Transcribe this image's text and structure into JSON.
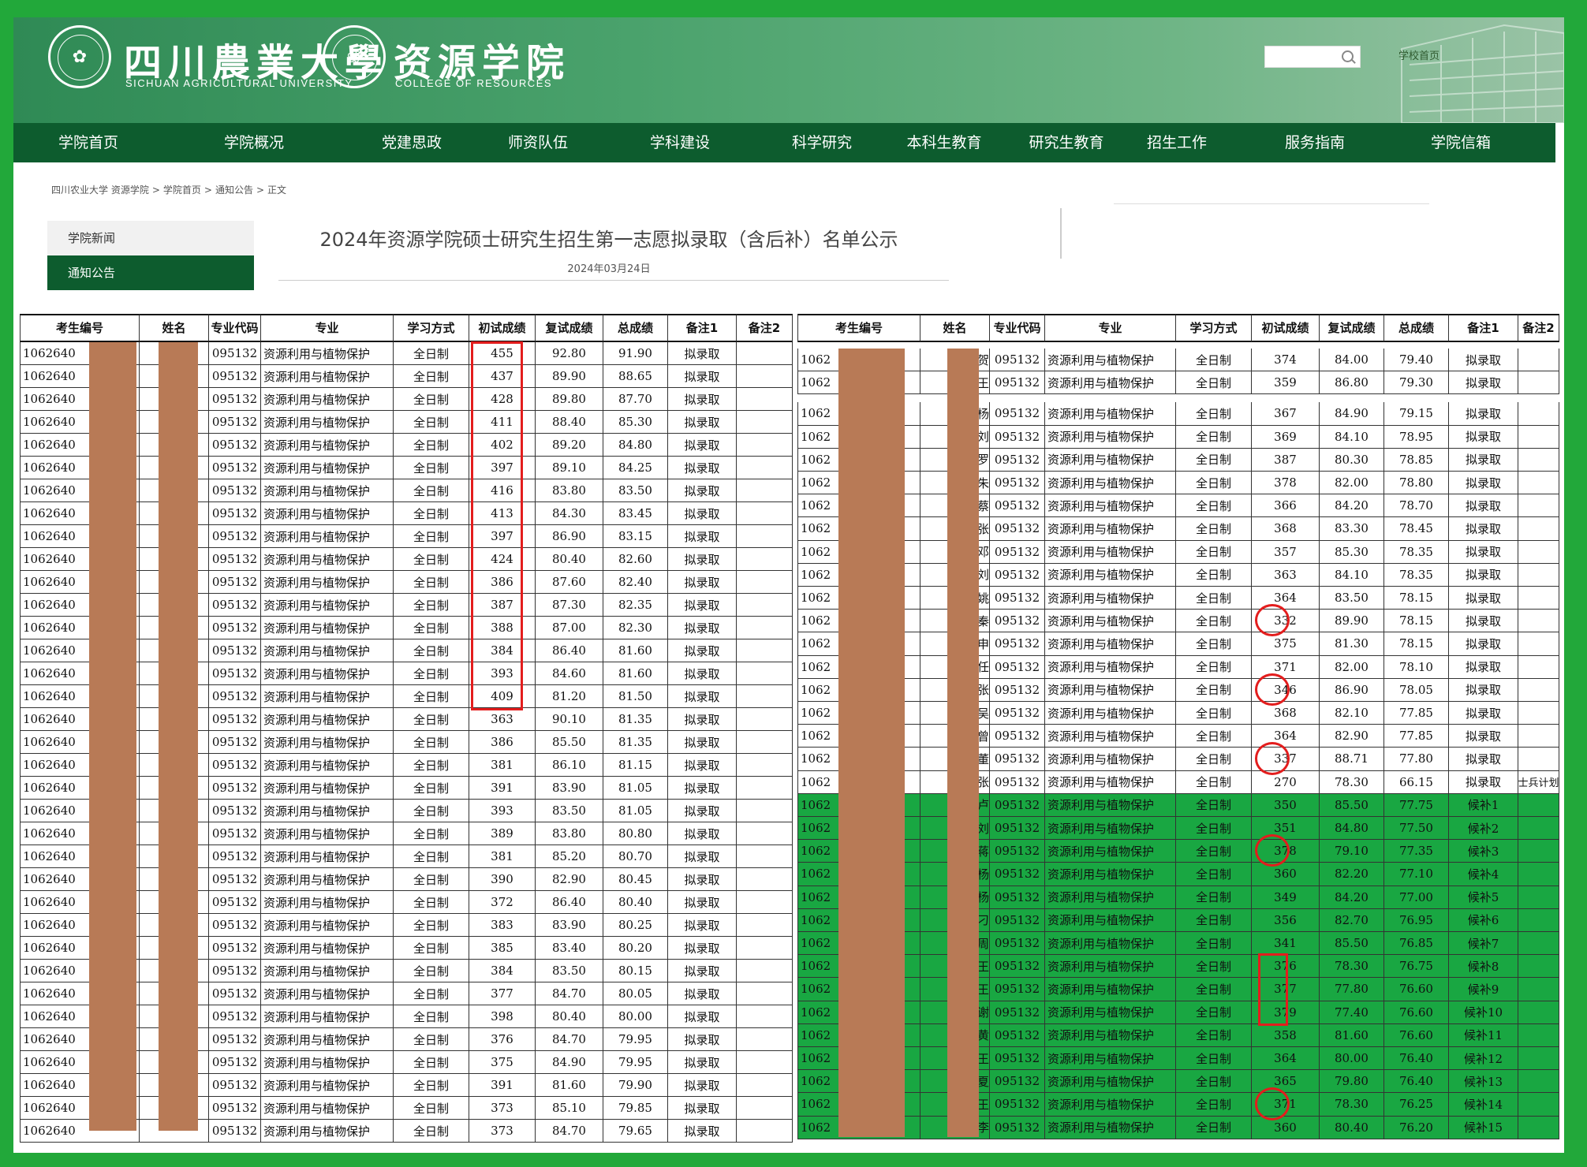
{
  "header": {
    "univ_cn": "四川農業大學",
    "univ_en": "SICHUAN AGRICULTURAL UNIVERSITY",
    "college_cn": "资源学院",
    "college_en": "COLLEGE OF RESOURCES",
    "home_link": "学校首页",
    "univ_seal_icon": "university-seal-icon",
    "college_seal_icon": "college-seal-icon",
    "search_icon": "search-icon"
  },
  "nav": [
    "学院首页",
    "学院概况",
    "党建思政",
    "师资队伍",
    "学科建设",
    "科学研究",
    "本科生教育",
    "研究生教育",
    "招生工作",
    "服务指南",
    "学院信箱"
  ],
  "breadcrumb": [
    "四川农业大学 资源学院",
    ">",
    "学院首页",
    ">",
    "通知公告",
    ">",
    "正文"
  ],
  "sidebar": [
    "学院新闻",
    "通知公告"
  ],
  "article": {
    "title": "2024年资源学院硕士研究生招生第一志愿拟录取（含后补）名单公示",
    "date": "2024年03月24日"
  },
  "table_headers": [
    "考生编号",
    "姓名",
    "专业代码",
    "专业",
    "学习方式",
    "初试成绩",
    "复试成绩",
    "总成绩",
    "备注1",
    "备注2"
  ],
  "common": {
    "id_prefix_left": "1062640",
    "id_prefix_right": "1062",
    "major_code": "095132",
    "major": "资源利用与植物保护",
    "study_mode": "全日制"
  },
  "left_rows": [
    [
      "455",
      "92.80",
      "91.90",
      "拟录取"
    ],
    [
      "437",
      "89.90",
      "88.65",
      "拟录取"
    ],
    [
      "428",
      "89.80",
      "87.70",
      "拟录取"
    ],
    [
      "411",
      "88.40",
      "85.30",
      "拟录取"
    ],
    [
      "402",
      "89.20",
      "84.80",
      "拟录取"
    ],
    [
      "397",
      "89.10",
      "84.25",
      "拟录取"
    ],
    [
      "416",
      "83.80",
      "83.50",
      "拟录取"
    ],
    [
      "413",
      "84.30",
      "83.45",
      "拟录取"
    ],
    [
      "397",
      "86.90",
      "83.15",
      "拟录取"
    ],
    [
      "424",
      "80.40",
      "82.60",
      "拟录取"
    ],
    [
      "386",
      "87.60",
      "82.40",
      "拟录取"
    ],
    [
      "387",
      "87.30",
      "82.35",
      "拟录取"
    ],
    [
      "388",
      "87.00",
      "82.30",
      "拟录取"
    ],
    [
      "384",
      "86.40",
      "81.60",
      "拟录取"
    ],
    [
      "393",
      "84.60",
      "81.60",
      "拟录取"
    ],
    [
      "409",
      "81.20",
      "81.50",
      "拟录取"
    ],
    [
      "363",
      "90.10",
      "81.35",
      "拟录取"
    ],
    [
      "386",
      "85.50",
      "81.35",
      "拟录取"
    ],
    [
      "381",
      "86.10",
      "81.15",
      "拟录取"
    ],
    [
      "391",
      "83.90",
      "81.05",
      "拟录取"
    ],
    [
      "393",
      "83.50",
      "81.05",
      "拟录取"
    ],
    [
      "389",
      "83.80",
      "80.80",
      "拟录取"
    ],
    [
      "381",
      "85.20",
      "80.70",
      "拟录取"
    ],
    [
      "390",
      "82.90",
      "80.45",
      "拟录取"
    ],
    [
      "372",
      "86.40",
      "80.40",
      "拟录取"
    ],
    [
      "383",
      "83.90",
      "80.25",
      "拟录取"
    ],
    [
      "385",
      "83.40",
      "80.20",
      "拟录取"
    ],
    [
      "384",
      "83.50",
      "80.15",
      "拟录取"
    ],
    [
      "377",
      "84.70",
      "80.05",
      "拟录取"
    ],
    [
      "398",
      "80.40",
      "80.00",
      "拟录取"
    ],
    [
      "376",
      "84.70",
      "79.95",
      "拟录取"
    ],
    [
      "375",
      "84.90",
      "79.95",
      "拟录取"
    ],
    [
      "391",
      "81.60",
      "79.90",
      "拟录取"
    ],
    [
      "373",
      "85.10",
      "79.85",
      "拟录取"
    ],
    [
      "373",
      "84.70",
      "79.65",
      "拟录取"
    ]
  ],
  "right_rows": [
    [
      "贺",
      "374",
      "84.00",
      "79.40",
      "拟录取",
      ""
    ],
    [
      "王",
      "359",
      "86.80",
      "79.30",
      "拟录取",
      ""
    ],
    [
      "杨",
      "367",
      "84.90",
      "79.15",
      "拟录取",
      ""
    ],
    [
      "刘",
      "369",
      "84.10",
      "78.95",
      "拟录取",
      ""
    ],
    [
      "罗",
      "387",
      "80.30",
      "78.85",
      "拟录取",
      ""
    ],
    [
      "朱",
      "378",
      "82.00",
      "78.80",
      "拟录取",
      ""
    ],
    [
      "蔡",
      "366",
      "84.20",
      "78.70",
      "拟录取",
      ""
    ],
    [
      "张",
      "368",
      "83.30",
      "78.45",
      "拟录取",
      ""
    ],
    [
      "邓",
      "357",
      "85.30",
      "78.35",
      "拟录取",
      ""
    ],
    [
      "刘",
      "363",
      "84.10",
      "78.35",
      "拟录取",
      ""
    ],
    [
      "姚",
      "364",
      "83.50",
      "78.15",
      "拟录取",
      ""
    ],
    [
      "秦",
      "332",
      "89.90",
      "78.15",
      "拟录取",
      ""
    ],
    [
      "申",
      "375",
      "81.30",
      "78.15",
      "拟录取",
      ""
    ],
    [
      "任",
      "371",
      "82.00",
      "78.10",
      "拟录取",
      ""
    ],
    [
      "张",
      "346",
      "86.90",
      "78.05",
      "拟录取",
      ""
    ],
    [
      "吴",
      "368",
      "82.10",
      "77.85",
      "拟录取",
      ""
    ],
    [
      "曾",
      "364",
      "82.90",
      "77.85",
      "拟录取",
      ""
    ],
    [
      "董",
      "337",
      "88.71",
      "77.80",
      "拟录取",
      ""
    ],
    [
      "张",
      "270",
      "78.30",
      "66.15",
      "拟录取",
      "士兵计划"
    ],
    [
      "卢",
      "350",
      "85.50",
      "77.75",
      "候补1",
      ""
    ],
    [
      "刘",
      "351",
      "84.80",
      "77.50",
      "候补2",
      ""
    ],
    [
      "蒋",
      "378",
      "79.10",
      "77.35",
      "候补3",
      ""
    ],
    [
      "杨",
      "360",
      "82.20",
      "77.10",
      "候补4",
      ""
    ],
    [
      "杨",
      "349",
      "84.20",
      "77.00",
      "候补5",
      ""
    ],
    [
      "刁",
      "356",
      "82.70",
      "76.95",
      "候补6",
      ""
    ],
    [
      "周",
      "341",
      "85.50",
      "76.85",
      "候补7",
      ""
    ],
    [
      "王",
      "376",
      "78.30",
      "76.75",
      "候补8",
      ""
    ],
    [
      "王",
      "377",
      "77.80",
      "76.60",
      "候补9",
      ""
    ],
    [
      "谢",
      "379",
      "77.40",
      "76.60",
      "候补10",
      ""
    ],
    [
      "黄",
      "358",
      "81.60",
      "76.60",
      "候补11",
      ""
    ],
    [
      "王",
      "364",
      "80.00",
      "76.40",
      "候补12",
      ""
    ],
    [
      "夏",
      "365",
      "79.80",
      "76.40",
      "候补13",
      ""
    ],
    [
      "王",
      "371",
      "78.30",
      "76.25",
      "候补14",
      ""
    ],
    [
      "李",
      "360",
      "80.40",
      "76.20",
      "候补15",
      ""
    ]
  ],
  "colors": {
    "highlight_green": "#19a742",
    "annotation_red": "#e31d1d",
    "redaction": "#b87a56",
    "nav_green": "#0d5c2e"
  }
}
